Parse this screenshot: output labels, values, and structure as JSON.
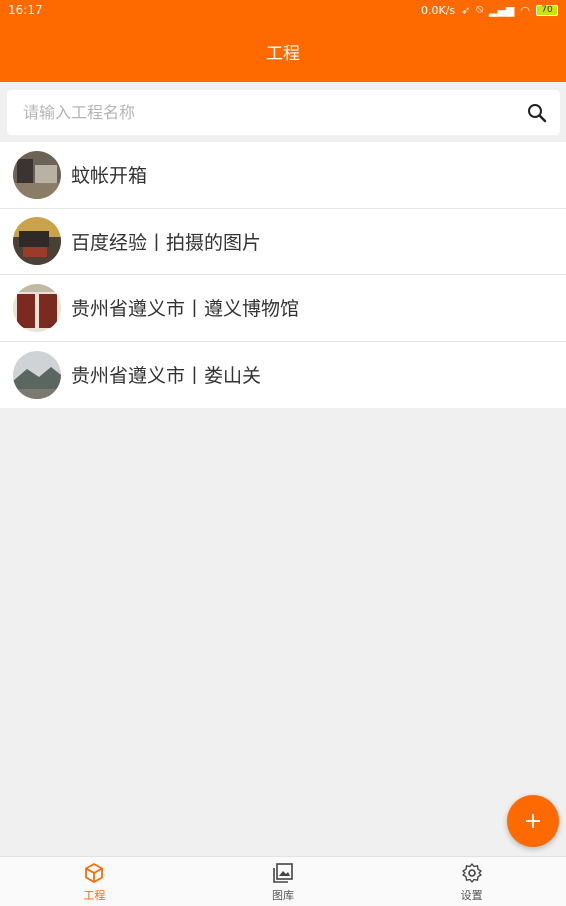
{
  "status_bar": {
    "time": "16:17",
    "speed": "0.0K/s",
    "battery": "70"
  },
  "header": {
    "title": "工程"
  },
  "search": {
    "placeholder": "请输入工程名称",
    "value": ""
  },
  "projects": [
    {
      "label": "蚊帐开箱"
    },
    {
      "label": "百度经验丨拍摄的图片"
    },
    {
      "label": "贵州省遵义市丨遵义博物馆"
    },
    {
      "label": "贵州省遵义市丨娄山关"
    }
  ],
  "fab": {
    "label": "+"
  },
  "bottom_nav": {
    "items": [
      {
        "label": "工程",
        "icon": "box-icon",
        "active": true
      },
      {
        "label": "图库",
        "icon": "gallery-icon",
        "active": false
      },
      {
        "label": "设置",
        "icon": "gear-icon",
        "active": false
      }
    ]
  },
  "colors": {
    "accent": "#ff6a00",
    "background": "#f0f0f0"
  }
}
